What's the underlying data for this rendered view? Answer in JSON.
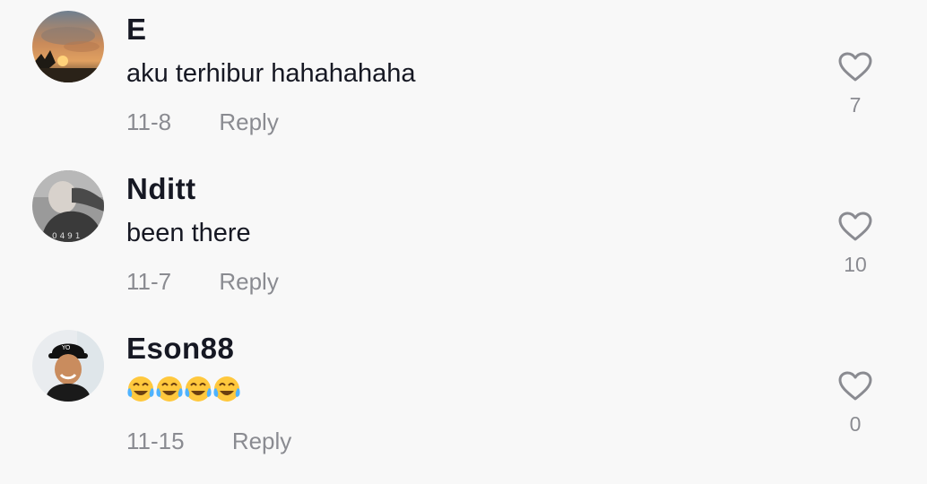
{
  "comments": [
    {
      "username": "E",
      "text": "aku terhibur hahahahaha",
      "date": "11-8",
      "reply_label": "Reply",
      "likes": "7",
      "avatar_icon": "sunset-avatar-icon"
    },
    {
      "username": "Nditt",
      "text": "been there",
      "date": "11-7",
      "reply_label": "Reply",
      "likes": "10",
      "avatar_icon": "person-avatar-icon"
    },
    {
      "username": "Eson88",
      "text": "😂😂😂😂",
      "date": "11-15",
      "reply_label": "Reply",
      "likes": "0",
      "avatar_icon": "smiling-man-avatar-icon"
    }
  ],
  "colors": {
    "background": "#f8f8f8",
    "primary_text": "#161823",
    "secondary_text": "#8a8b91"
  }
}
